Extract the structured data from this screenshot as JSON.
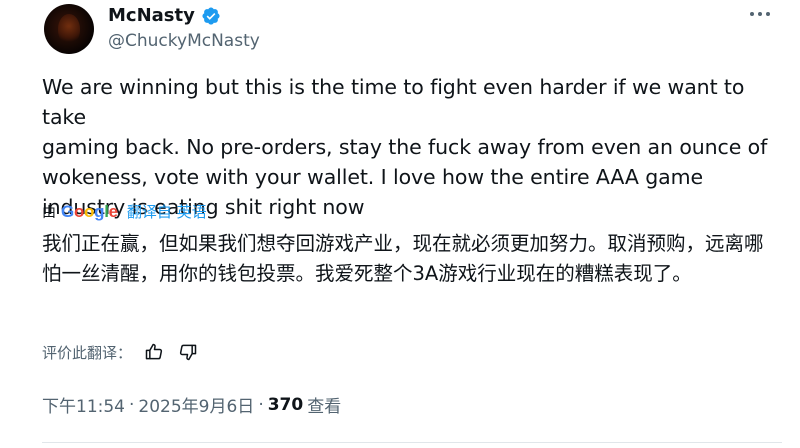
{
  "author": {
    "display_name": "McNasty",
    "handle": "@ChuckyMcNasty",
    "verified": true
  },
  "tweet": {
    "text": "We are winning but this is the time to fight even harder if we want to take\ngaming back. No pre-orders, stay the fuck away from even an ounce of\nwokeness, vote with your wallet. I love how the entire AAA game\nindustry is eating shit right now",
    "translation_prefix": "由",
    "translation_provider": "Google",
    "translation_link": "翻译自 英语",
    "translated_text": "我们正在赢，但如果我们想夺回游戏产业，现在就必须更加努力。取消预购，远离哪怕一丝清醒，用你的钱包投票。我爱死整个3A游戏行业现在的糟糕表现了。",
    "rate_label": "评价此翻译：",
    "time": "下午11:54",
    "date": "2025年9月6日",
    "separator": "·",
    "views": "370",
    "views_label": "查看"
  },
  "colors": {
    "text": "#0f1419",
    "secondary": "#536471",
    "link": "#1d9bf0",
    "verified": "#1d9bf0"
  },
  "icons": [
    "verified-badge-icon",
    "more-options-icon",
    "thumbs-up-icon",
    "thumbs-down-icon"
  ]
}
